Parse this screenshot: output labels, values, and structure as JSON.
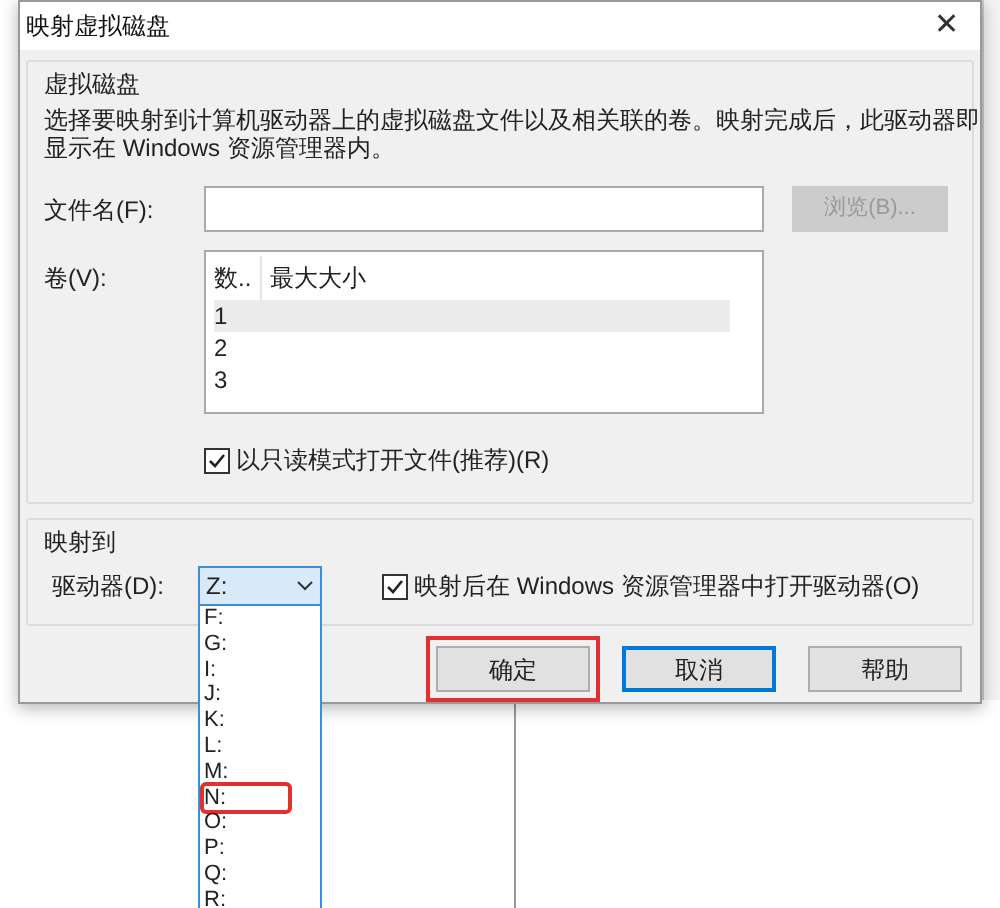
{
  "window": {
    "title": "映射虚拟磁盘",
    "close": "✕"
  },
  "virtual_disk": {
    "title": "虚拟磁盘",
    "description": "选择要映射到计算机驱动器上的虚拟磁盘文件以及相关联的卷。映射完成后，此驱动器即显示在 Windows 资源管理器内。",
    "file_label": "文件名(F):",
    "browse": {
      "label": "浏览(B)...",
      "disabled": true
    },
    "volumes_label": "卷(V):",
    "columns": [
      "数..",
      "最大大小"
    ],
    "rows": [
      {
        "number": "1",
        "selected": true
      },
      {
        "number": "2",
        "selected": false
      },
      {
        "number": "3",
        "selected": false
      }
    ],
    "readonly": {
      "label": "以只读模式打开文件(推荐)(R)",
      "checked": true
    }
  },
  "map_to": {
    "title": "映射到",
    "drive_label": "驱动器(D):",
    "drive_value": "Z:",
    "open_in_explorer": {
      "label": "映射后在 Windows 资源管理器中打开驱动器(O)",
      "checked": true
    }
  },
  "buttons": [
    {
      "label": "确定",
      "default": false,
      "highlighted": true
    },
    {
      "label": "取消",
      "default": true,
      "highlighted": false
    },
    {
      "label": "帮助",
      "default": false,
      "highlighted": false
    }
  ],
  "drive_options": [
    {
      "label": "F:",
      "highlighted": false
    },
    {
      "label": "G:",
      "highlighted": false
    },
    {
      "label": "I:",
      "highlighted": false
    },
    {
      "label": "J:",
      "highlighted": false
    },
    {
      "label": "K:",
      "highlighted": false
    },
    {
      "label": "L:",
      "highlighted": false
    },
    {
      "label": "M:",
      "highlighted": false
    },
    {
      "label": "N:",
      "highlighted": true
    },
    {
      "label": "O:",
      "highlighted": false
    },
    {
      "label": "P:",
      "highlighted": false
    },
    {
      "label": "Q:",
      "highlighted": false
    },
    {
      "label": "R:",
      "highlighted": false
    }
  ]
}
